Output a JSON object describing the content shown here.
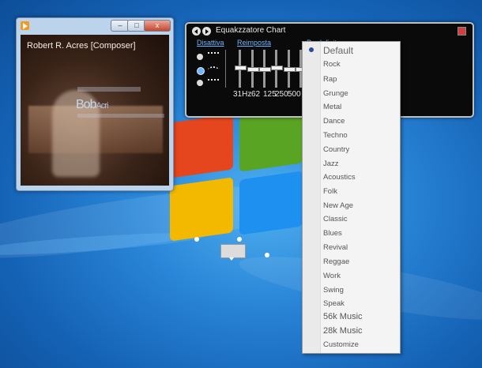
{
  "player": {
    "album_title": "Robert R. Acres [Composer]",
    "album_art_name": "Bob",
    "album_art_name2": "Acri",
    "buttons": {
      "minimize": "–",
      "maximize": "□",
      "close": "x"
    }
  },
  "equalizer": {
    "title": "Equakzzatore Chart",
    "links": {
      "disable": "Disattiva",
      "reset": "Reimposta",
      "preset": "Predefinito"
    },
    "frequencies": [
      "31Hz",
      "62",
      "125",
      "250",
      "500"
    ],
    "bands": [
      0.55,
      0.5,
      0.5,
      0.55,
      0.5,
      0.5
    ],
    "selected_mode": 2
  },
  "preset_menu": {
    "selected": "Default",
    "items": [
      "Default",
      "Rock",
      "Rap",
      "Grunge",
      "Metal",
      "Dance",
      "Techno",
      "Country",
      "Jazz",
      "Acoustics",
      "Folk",
      "New Age",
      "Classic",
      "Blues",
      "Revival",
      "Reggae",
      "Work",
      "Swing",
      "Speak",
      "56k Music",
      "28k Music",
      "Customize"
    ]
  }
}
